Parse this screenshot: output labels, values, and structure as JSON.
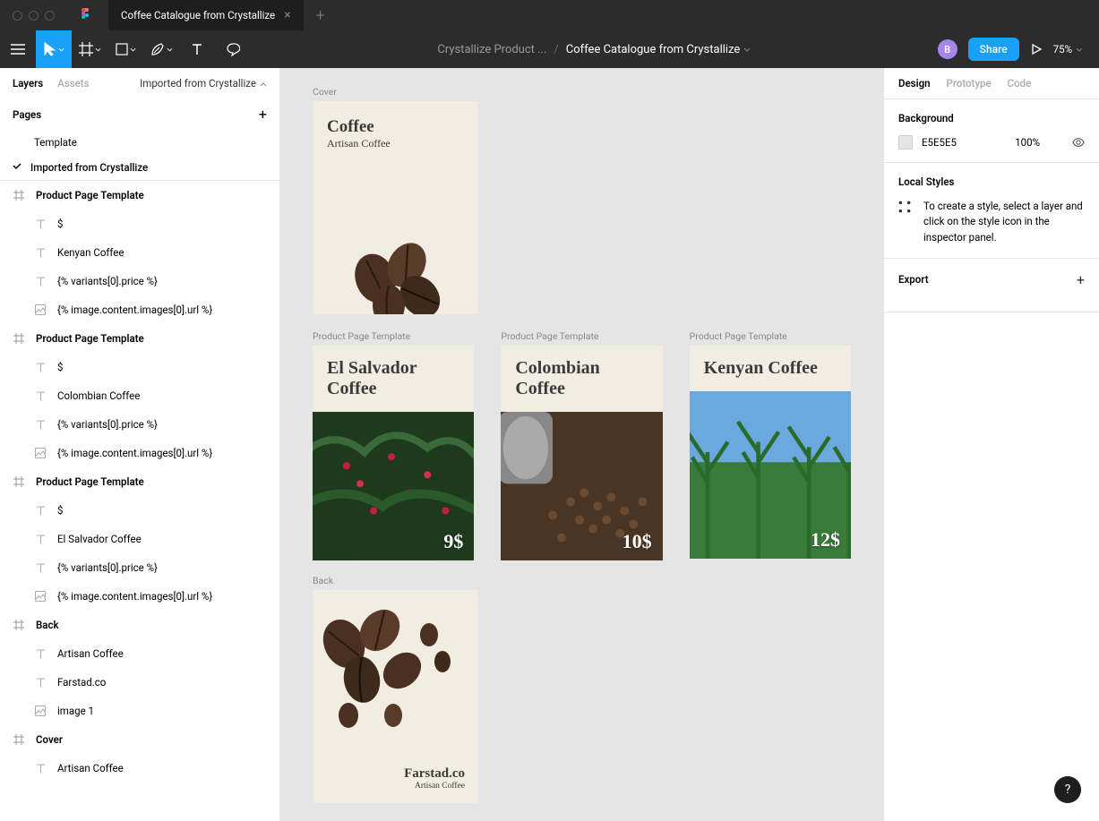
{
  "window": {
    "tab_title": "Coffee Catalogue from Crystallize"
  },
  "toolbar": {
    "breadcrumb_parent": "Crystallize Product ...",
    "breadcrumb_current": "Coffee Catalogue from Crystallize",
    "avatar_initial": "B",
    "share_label": "Share",
    "zoom": "75%"
  },
  "left_panel": {
    "tab_layers": "Layers",
    "tab_assets": "Assets",
    "page_selector": "Imported from Crystallize",
    "pages_header": "Pages",
    "pages": {
      "template": "Template",
      "imported": "Imported from Crystallize"
    },
    "layers": {
      "f1": "Product Page Template",
      "f1_children": [
        "$",
        "Kenyan Coffee",
        "{% variants[0].price %}",
        "{% image.content.images[0].url %}"
      ],
      "f2": "Product Page Template",
      "f2_children": [
        "$",
        "Colombian Coffee",
        "{% variants[0].price %}",
        "{% image.content.images[0].url %}"
      ],
      "f3": "Product Page Template",
      "f3_children": [
        "$",
        "El Salvador Coffee",
        "{% variants[0].price %}",
        "{% image.content.images[0].url %}"
      ],
      "f4": "Back",
      "f4_children": [
        "Artisan Coffee",
        "Farstad.co",
        "image 1"
      ],
      "f5": "Cover",
      "f5_children": [
        "Artisan Coffee"
      ]
    }
  },
  "canvas": {
    "cover_label": "Cover",
    "cover": {
      "title": "Coffee",
      "subtitle": "Artisan Coffee"
    },
    "ppt_label": "Product Page Template",
    "products": [
      {
        "title": "El Salvador Coffee",
        "price": "9$"
      },
      {
        "title": "Colombian Coffee",
        "price": "10$"
      },
      {
        "title": "Kenyan Coffee",
        "price": "12$"
      }
    ],
    "back_label": "Back",
    "back": {
      "brand": "Farstad.co",
      "subtitle": "Artisan Coffee"
    }
  },
  "right_panel": {
    "tab_design": "Design",
    "tab_prototype": "Prototype",
    "tab_code": "Code",
    "background_header": "Background",
    "bg_hex": "E5E5E5",
    "bg_opacity": "100%",
    "local_styles_header": "Local Styles",
    "local_styles_body": "To create a style, select a layer and click on the style icon in the inspector panel.",
    "export_header": "Export"
  },
  "help": "?"
}
